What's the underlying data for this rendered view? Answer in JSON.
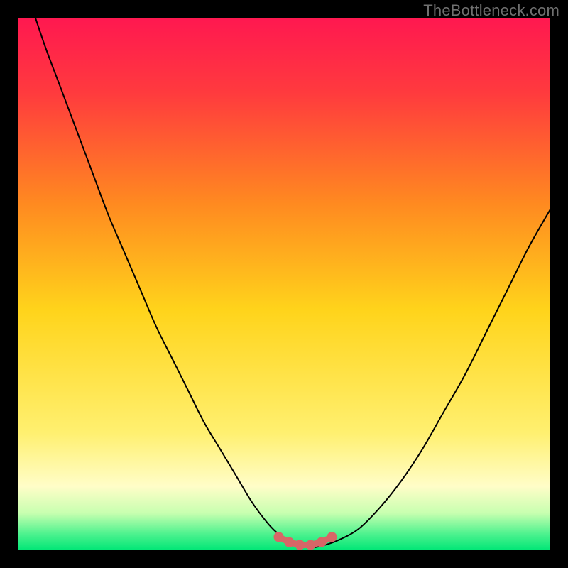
{
  "attribution": "TheBottleneck.com",
  "colors": {
    "frame": "#000000",
    "gradient_top": "#ff1850",
    "gradient_upper_mid": "#ff8a20",
    "gradient_mid": "#ffd41b",
    "gradient_lower_mid": "#fff6a0",
    "gradient_bottom": "#00e676",
    "curve": "#000000",
    "marker_fill": "#d76667",
    "marker_stroke": "#d76667"
  },
  "chart_data": {
    "type": "line",
    "title": "",
    "xlabel": "",
    "ylabel": "",
    "xlim": [
      0,
      100
    ],
    "ylim": [
      0,
      100
    ],
    "series": [
      {
        "name": "bottleneck-curve",
        "x": [
          0,
          2,
          5,
          8,
          11,
          14,
          17,
          20,
          23,
          26,
          29,
          32,
          35,
          38,
          41,
          44,
          47,
          49,
          51,
          53,
          55,
          57,
          60,
          64,
          68,
          72,
          76,
          80,
          84,
          88,
          92,
          96,
          100
        ],
        "y": [
          110,
          104,
          95,
          87,
          79,
          71,
          63,
          56,
          49,
          42,
          36,
          30,
          24,
          19,
          14,
          9,
          5,
          3,
          1.5,
          0.8,
          0.5,
          0.8,
          1.8,
          4,
          8,
          13,
          19,
          26,
          33,
          41,
          49,
          57,
          64
        ]
      }
    ],
    "markers": {
      "name": "valley-markers",
      "points": [
        {
          "x": 49,
          "y": 2.5
        },
        {
          "x": 51,
          "y": 1.5
        },
        {
          "x": 53,
          "y": 1.0
        },
        {
          "x": 55,
          "y": 1.0
        },
        {
          "x": 57,
          "y": 1.5
        },
        {
          "x": 59,
          "y": 2.5
        }
      ]
    },
    "gradient_stops": [
      {
        "offset": 0.0,
        "color": "#ff1850"
      },
      {
        "offset": 0.14,
        "color": "#ff3a3e"
      },
      {
        "offset": 0.35,
        "color": "#ff8a20"
      },
      {
        "offset": 0.55,
        "color": "#ffd41b"
      },
      {
        "offset": 0.78,
        "color": "#fff070"
      },
      {
        "offset": 0.88,
        "color": "#fffdc8"
      },
      {
        "offset": 0.93,
        "color": "#c8ffb0"
      },
      {
        "offset": 0.97,
        "color": "#4cf28e"
      },
      {
        "offset": 1.0,
        "color": "#00e676"
      }
    ]
  }
}
